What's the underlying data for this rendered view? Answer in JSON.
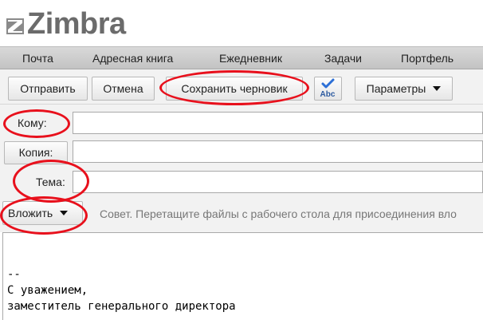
{
  "app": {
    "logo_text": "Zimbra"
  },
  "nav": {
    "items": [
      "Почта",
      "Адресная книга",
      "Ежедневник",
      "Задачи",
      "Портфель"
    ]
  },
  "toolbar": {
    "send_label": "Отправить",
    "cancel_label": "Отмена",
    "save_draft_label": "Сохранить черновик",
    "spellcheck_icon_text": "Abc",
    "options_label": "Параметры"
  },
  "compose": {
    "to_label": "Кому:",
    "cc_label": "Копия:",
    "subject_label": "Тема:",
    "attach_label": "Вложить",
    "hint": "Совет. Перетащите файлы с рабочего стола для присоединения вло",
    "to_value": "",
    "cc_value": "",
    "subject_value": ""
  },
  "signature": {
    "separator": "--",
    "line1": "С уважением,",
    "line2": "заместитель генерального директора"
  },
  "colors": {
    "brand_red": "#b5132c",
    "annotation_red": "#e8101c",
    "logo_grey": "#6b6b6b"
  }
}
